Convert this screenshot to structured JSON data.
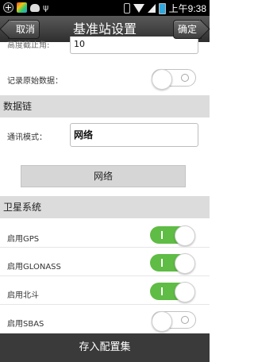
{
  "status_bar": {
    "time": "上午9:38"
  },
  "header": {
    "back_label": "取消",
    "title": "基准站设置",
    "confirm_label": "确定"
  },
  "fields": {
    "cutoff_label": "高度截止角:",
    "cutoff_value": "10",
    "record_raw_label": "记录原始数据："
  },
  "data_link": {
    "section_title": "数据链",
    "mode_label": "通讯模式：",
    "mode_value": "网络",
    "button_label": "网络"
  },
  "satellite": {
    "section_title": "卫星系统",
    "items": [
      {
        "label": "启用GPS",
        "state": "on"
      },
      {
        "label": "启用GLONASS",
        "state": "on"
      },
      {
        "label": "启用北斗",
        "state": "on"
      },
      {
        "label": "启用SBAS",
        "state": "off"
      }
    ]
  },
  "footer": {
    "save_label": "存入配置集"
  },
  "colors": {
    "toggle_on": "#5fbc45",
    "section_bg": "#dcdcdc",
    "header_bg": "#3a3a3a"
  }
}
